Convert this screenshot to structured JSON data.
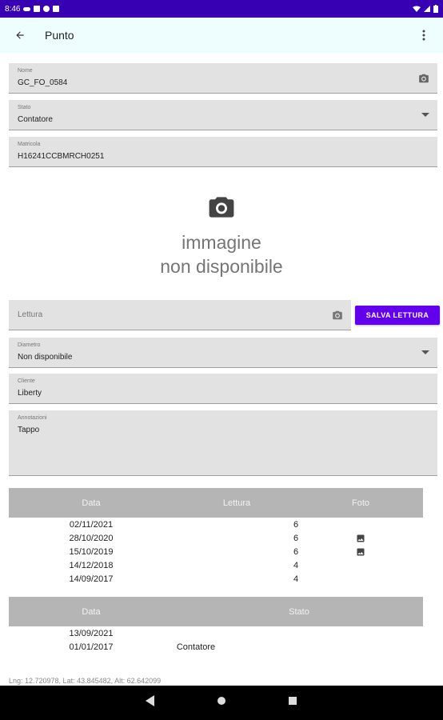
{
  "statusbar": {
    "time": "8:46"
  },
  "appbar": {
    "title": "Punto"
  },
  "form": {
    "nome": {
      "label": "Nome",
      "value": "GC_FO_0584"
    },
    "stato": {
      "label": "Stato",
      "value": "Contatore"
    },
    "matricola": {
      "label": "Matricola",
      "value": "H16241CCBMRCH0251"
    }
  },
  "image_placeholder": {
    "line1": "immagine",
    "line2": "non disponibile"
  },
  "lettura": {
    "placeholder": "Lettura",
    "save_label": "SALVA LETTURA"
  },
  "form2": {
    "diametro": {
      "label": "Diametro",
      "value": "Non disponibile"
    },
    "cliente": {
      "label": "Cliente",
      "value": "Liberty"
    },
    "annotazioni": {
      "label": "Annotazioni",
      "value": "Tappo"
    }
  },
  "letture_table": {
    "headers": [
      "Data",
      "Lettura",
      "Foto"
    ],
    "rows": [
      {
        "data": "02/11/2021",
        "lettura": "6",
        "foto": false
      },
      {
        "data": "28/10/2020",
        "lettura": "6",
        "foto": true
      },
      {
        "data": "15/10/2019",
        "lettura": "6",
        "foto": true
      },
      {
        "data": "14/12/2018",
        "lettura": "4",
        "foto": false
      },
      {
        "data": "14/09/2017",
        "lettura": "4",
        "foto": false
      }
    ]
  },
  "stati_table": {
    "headers": [
      "Data",
      "Stato"
    ],
    "rows": [
      {
        "data": "13/09/2021",
        "stato": ""
      },
      {
        "data": "01/01/2017",
        "stato": "Contatore"
      }
    ]
  },
  "coords": "Lng: 12.720978, Lat: 43.845482, Alt: 62.642099"
}
